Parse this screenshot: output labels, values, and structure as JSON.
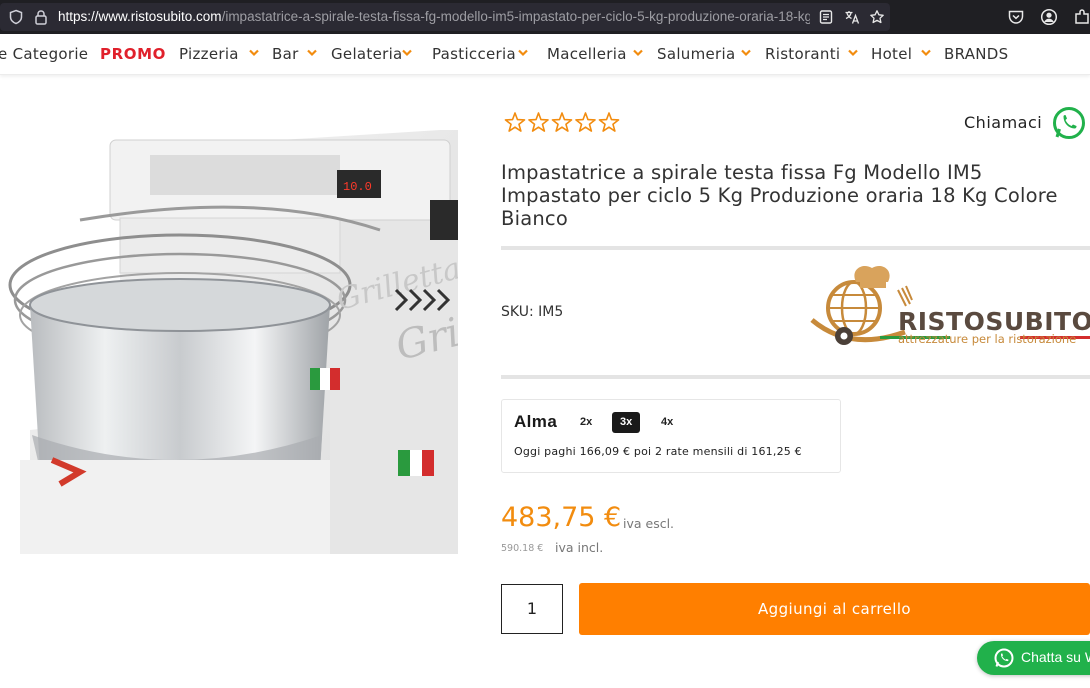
{
  "browser": {
    "url_host": "https://www.ristosubito.com",
    "url_path": "/impastatrice-a-spirale-testa-fissa-fg-modello-im5-impastato-per-ciclo-5-kg-produzione-oraria-18-kg-co",
    "icons": [
      "shield-icon",
      "lock-icon",
      "reader-view-icon",
      "translate-icon",
      "bookmark-star-icon",
      "pocket-icon",
      "account-icon",
      "extensions-icon"
    ]
  },
  "nav": {
    "items": [
      {
        "label": "e Categorie",
        "dropdown": false
      },
      {
        "label": "PROMO",
        "dropdown": false,
        "highlight": "#e0202b"
      },
      {
        "label": "Pizzeria",
        "dropdown": true
      },
      {
        "label": "Bar",
        "dropdown": true
      },
      {
        "label": "Gelateria",
        "dropdown": true
      },
      {
        "label": "Pasticceria",
        "dropdown": true
      },
      {
        "label": "Macelleria",
        "dropdown": true
      },
      {
        "label": "Salumeria",
        "dropdown": true
      },
      {
        "label": "Ristoranti",
        "dropdown": true
      },
      {
        "label": "Hotel",
        "dropdown": true
      },
      {
        "label": "BRANDS",
        "dropdown": false
      }
    ],
    "chevron_color": "#f28c0f"
  },
  "product": {
    "rating_stars": 0,
    "rating_max": 5,
    "call_label": "Chiamaci",
    "title": "Impastatrice a spirale testa fissa Fg Modello IM5 Impastato per ciclo 5 Kg Produzione oraria 18 Kg Colore Bianco",
    "sku": "SKU: IM5",
    "image_brand_text": "Grilletta",
    "price": "483,75 €",
    "price_note": "iva escl.",
    "price_incl": "590.18 €",
    "price_incl_note": "iva incl.",
    "quantity": "1",
    "add_to_cart": "Aggiungi al carrello"
  },
  "logo": {
    "name": "RISTOSUBITO",
    "tagline": "attrezzature per la ristorazione"
  },
  "alma": {
    "brand": "Alma",
    "options": [
      "2x",
      "3x",
      "4x"
    ],
    "selected": "3x",
    "text": "Oggi paghi 166,09 € poi 2 rate mensili di 161,25 €"
  },
  "chat": {
    "label": "Chatta su W",
    "color": "#21b14b"
  },
  "colors": {
    "accent_orange": "#ff7f00",
    "price_orange": "#f28c0f",
    "promo_red": "#e0202b",
    "whatsapp_green": "#21b14b"
  }
}
